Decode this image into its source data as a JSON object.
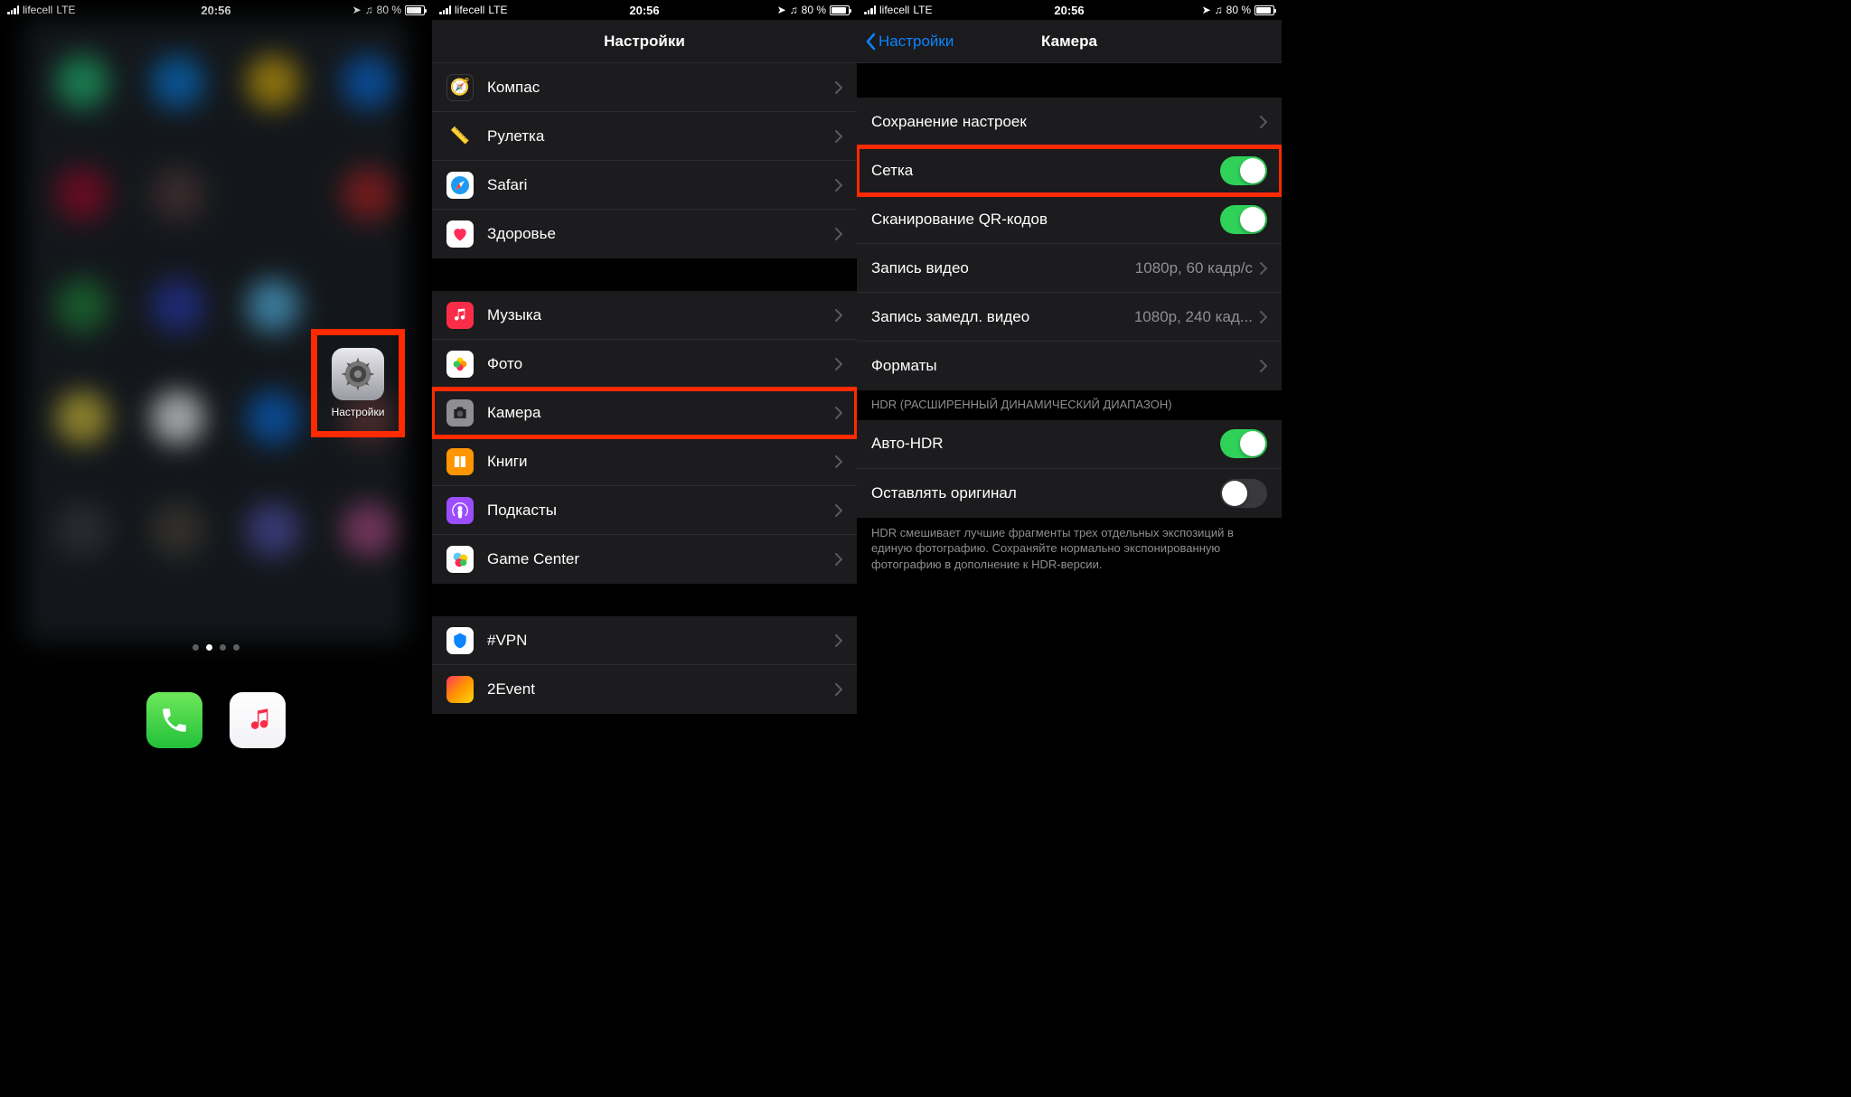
{
  "status": {
    "carrier": "lifecell",
    "network": "LTE",
    "time": "20:56",
    "battery_pct": "80 %"
  },
  "screen1": {
    "settings_label": "Настройки"
  },
  "screen2": {
    "title": "Настройки",
    "groups": [
      {
        "items": [
          {
            "key": "compass",
            "label": "Компас"
          },
          {
            "key": "ruler",
            "label": "Рулетка"
          },
          {
            "key": "safari",
            "label": "Safari"
          },
          {
            "key": "health",
            "label": "Здоровье"
          }
        ]
      },
      {
        "items": [
          {
            "key": "music",
            "label": "Музыка"
          },
          {
            "key": "photos",
            "label": "Фото"
          },
          {
            "key": "camera",
            "label": "Камера",
            "highlight": true
          },
          {
            "key": "books",
            "label": "Книги"
          },
          {
            "key": "podcasts",
            "label": "Подкасты"
          },
          {
            "key": "gamecenter",
            "label": "Game Center"
          }
        ]
      },
      {
        "items": [
          {
            "key": "vpn",
            "label": "#VPN"
          },
          {
            "key": "2event",
            "label": "2Event"
          }
        ]
      }
    ]
  },
  "screen3": {
    "back": "Настройки",
    "title": "Камера",
    "rows": {
      "preserve": {
        "label": "Сохранение настроек"
      },
      "grid": {
        "label": "Сетка",
        "on": true,
        "highlight": true
      },
      "qr": {
        "label": "Сканирование QR-кодов",
        "on": true
      },
      "video": {
        "label": "Запись видео",
        "value": "1080p, 60 кадр/с"
      },
      "slomo": {
        "label": "Запись замедл. видео",
        "value": "1080p, 240 кад..."
      },
      "formats": {
        "label": "Форматы"
      }
    },
    "hdr": {
      "header": "HDR (РАСШИРЕННЫЙ ДИНАМИЧЕСКИЙ ДИАПАЗОН)",
      "auto": {
        "label": "Авто-HDR",
        "on": true
      },
      "keep": {
        "label": "Оставлять оригинал",
        "on": false
      },
      "footer": "HDR смешивает лучшие фрагменты трех отдельных экспозиций в единую фотографию. Сохраняйте нормально экспонированную фотографию в дополнение к HDR-версии."
    }
  }
}
